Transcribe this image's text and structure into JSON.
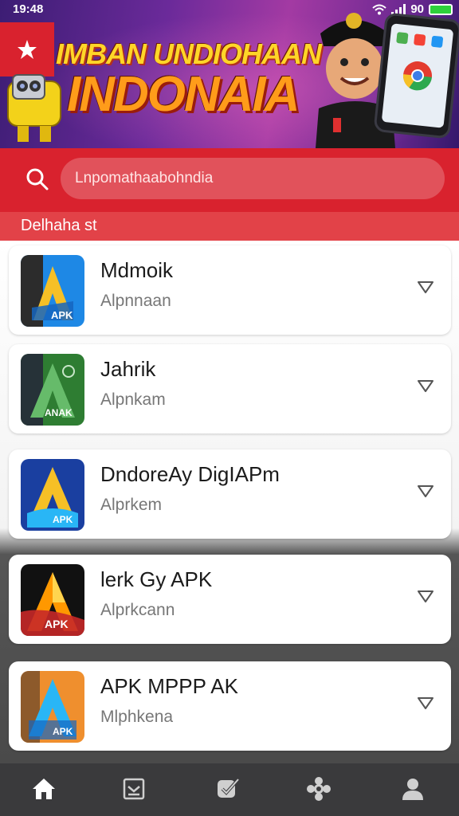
{
  "status_bar": {
    "time": "19:48",
    "battery_text": "90",
    "icons": [
      "wifi-icon",
      "signal-icon",
      "battery-icon"
    ]
  },
  "banner": {
    "title_line1": "IMBAN UNDIOHAAN",
    "title_line2": "INDONAIA",
    "colors": {
      "title_line1": "#ffd628",
      "title_line2": "#ff9c1a",
      "logo_tile": "#d9222e"
    }
  },
  "search": {
    "placeholder": "Lnpomathaabohndia",
    "icon": "search-icon"
  },
  "section": {
    "title": "Delhaha st"
  },
  "apps": [
    {
      "name": "Mdmoik",
      "subtitle": "Alpnnaan",
      "icon_label": "APK"
    },
    {
      "name": "Jahrik",
      "subtitle": "Alpnkam",
      "icon_label": "ANAK"
    },
    {
      "name": "DndoreAy DigIAPm",
      "subtitle": "Alprkem",
      "icon_label": "APK"
    },
    {
      "name": "lerk Gy APK",
      "subtitle": "Alprkcann",
      "icon_label": "APK"
    },
    {
      "name": "APK MPPP AK",
      "subtitle": "Mlphkena",
      "icon_label": "APK"
    }
  ],
  "bottom_nav": {
    "items": [
      "home-icon",
      "gallery-icon",
      "check-icon",
      "settings-icon",
      "profile-icon"
    ]
  },
  "colors": {
    "accent": "#d9222e",
    "nav_bg": "#3a3a3c"
  }
}
